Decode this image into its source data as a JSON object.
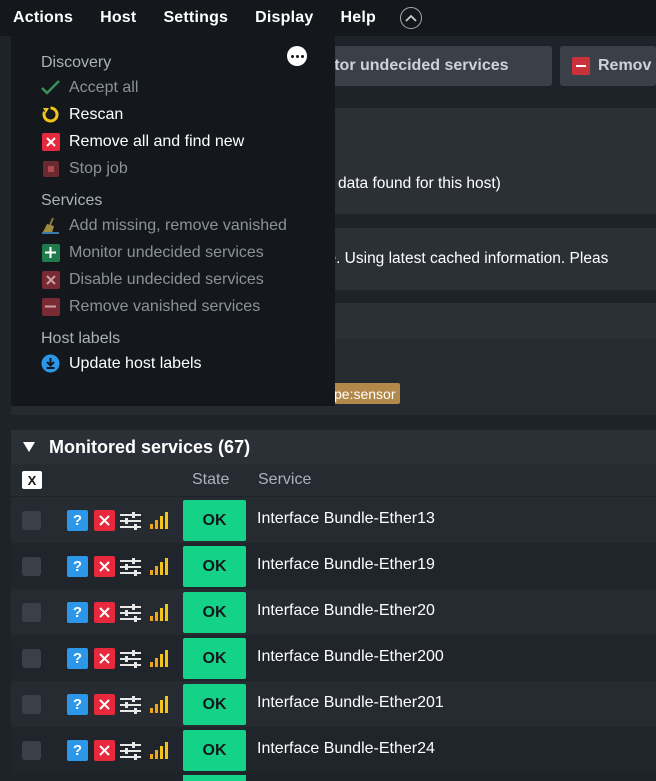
{
  "menubar": {
    "items": [
      "Actions",
      "Host",
      "Settings",
      "Display",
      "Help"
    ]
  },
  "background": {
    "button_monitor": "nitor undecided services",
    "button_remove": "Remov",
    "text_data_found": "data found for this host)",
    "text_cached": "le. Using latest cached information. Pleas",
    "tag_sensor": "pe:sensor"
  },
  "dropdown": {
    "sections": [
      {
        "title": "Discovery",
        "items": [
          {
            "label": "Accept all",
            "icon": "checkmark-icon",
            "enabled": false
          },
          {
            "label": "Rescan",
            "icon": "rescan-icon",
            "enabled": true
          },
          {
            "label": "Remove all and find new",
            "icon": "remove-all-icon",
            "enabled": true
          },
          {
            "label": "Stop job",
            "icon": "stop-icon",
            "enabled": false
          }
        ]
      },
      {
        "title": "Services",
        "items": [
          {
            "label": "Add missing, remove vanished",
            "icon": "broom-icon",
            "enabled": false
          },
          {
            "label": "Monitor undecided services",
            "icon": "plus-icon",
            "enabled": false
          },
          {
            "label": "Disable undecided services",
            "icon": "close-icon",
            "enabled": false
          },
          {
            "label": "Remove vanished services",
            "icon": "minus-icon",
            "enabled": false
          }
        ]
      },
      {
        "title": "Host labels",
        "items": [
          {
            "label": "Update host labels",
            "icon": "download-icon",
            "enabled": true
          }
        ]
      }
    ]
  },
  "services": {
    "header": "Monitored services (67)",
    "toggle_all": "X",
    "col_state": "State",
    "col_service": "Service",
    "rows": [
      {
        "state": "OK",
        "name": "Interface Bundle-Ether13"
      },
      {
        "state": "OK",
        "name": "Interface Bundle-Ether19"
      },
      {
        "state": "OK",
        "name": "Interface Bundle-Ether20"
      },
      {
        "state": "OK",
        "name": "Interface Bundle-Ether200"
      },
      {
        "state": "OK",
        "name": "Interface Bundle-Ether201"
      },
      {
        "state": "OK",
        "name": "Interface Bundle-Ether24"
      }
    ]
  },
  "colors": {
    "ok_green": "#14d389",
    "help_blue": "#2c97e8",
    "danger_red": "#e8283c",
    "label_tag": "#b2894a"
  }
}
